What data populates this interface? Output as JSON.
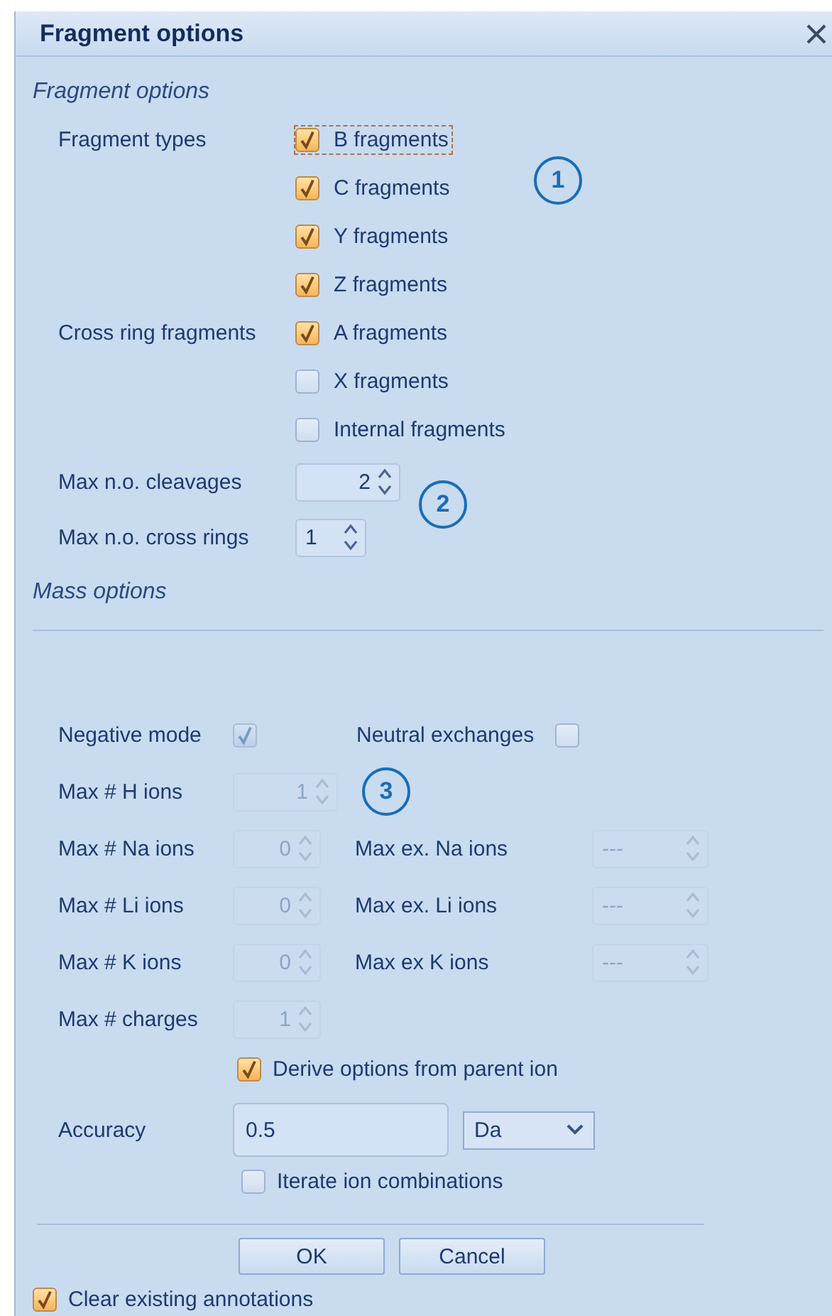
{
  "window": {
    "title": "Fragment options"
  },
  "fragment_options": {
    "heading": "Fragment options",
    "groups": [
      {
        "label": "Fragment types",
        "items": [
          {
            "label": "B fragments",
            "checked": true,
            "focused": true
          },
          {
            "label": "C fragments",
            "checked": true,
            "focused": false
          },
          {
            "label": "Y fragments",
            "checked": true,
            "focused": false
          },
          {
            "label": "Z fragments",
            "checked": true,
            "focused": false
          }
        ]
      },
      {
        "label": "Cross ring fragments",
        "items": [
          {
            "label": "A fragments",
            "checked": true,
            "focused": false
          },
          {
            "label": "X fragments",
            "checked": false,
            "focused": false
          },
          {
            "label": "Internal fragments",
            "checked": false,
            "focused": false
          }
        ]
      }
    ],
    "callout": "1",
    "spinners": [
      {
        "label": "Max n.o. cleavages",
        "value": "2",
        "disabled": false,
        "kind": "wide"
      },
      {
        "label": "Max n.o. cross rings",
        "value": "1",
        "disabled": false,
        "kind": "narrow"
      }
    ],
    "spinner_callout": "2"
  },
  "mass_options": {
    "heading": "Mass options",
    "negative_mode": {
      "label": "Negative mode",
      "checked": true,
      "disabled": true
    },
    "neutral_exchanges": {
      "label": "Neutral exchanges",
      "checked": false,
      "disabled": false
    },
    "ion_rows": [
      {
        "label": "Max # H ions",
        "value": "1",
        "disabled": true,
        "kind": "wide",
        "callout": "3"
      },
      {
        "label": "Max # Na ions",
        "value": "0",
        "disabled": true,
        "kind": "normal",
        "exchange": {
          "label": "Max ex. Na ions",
          "value": "---",
          "disabled": true
        }
      },
      {
        "label": "Max # Li ions",
        "value": "0",
        "disabled": true,
        "kind": "normal",
        "exchange": {
          "label": "Max ex. Li ions",
          "value": "---",
          "disabled": true
        }
      },
      {
        "label": "Max # K ions",
        "value": "0",
        "disabled": true,
        "kind": "normal",
        "exchange": {
          "label": "Max ex K ions",
          "value": "---",
          "disabled": true
        }
      },
      {
        "label": "Max # charges",
        "value": "1",
        "disabled": true,
        "kind": "normal"
      }
    ],
    "derive": {
      "label": "Derive options from parent ion",
      "checked": true
    },
    "accuracy": {
      "label": "Accuracy",
      "value": "0.5",
      "unit": "Da"
    },
    "iterate": {
      "label": "Iterate ion combinations",
      "checked": false
    }
  },
  "buttons": [
    "OK",
    "Cancel"
  ],
  "clear_annotations": {
    "label": "Clear existing annotations",
    "checked": true
  }
}
